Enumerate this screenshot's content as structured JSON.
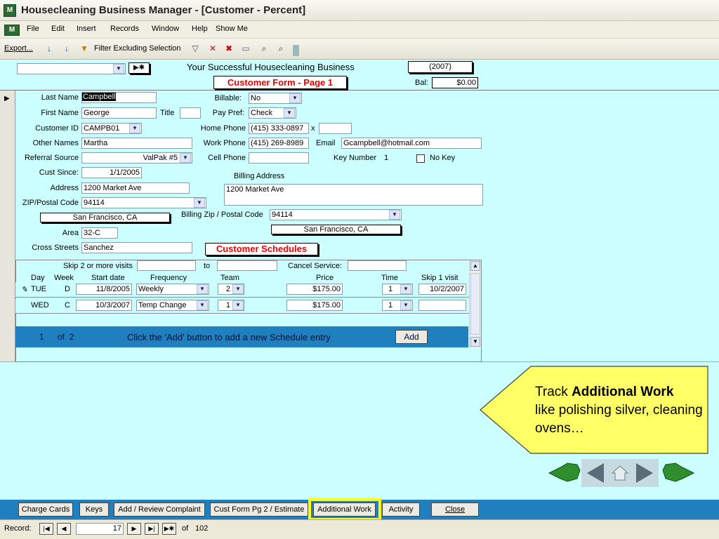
{
  "window": {
    "title": "Housecleaning Business Manager - [Customer - Percent]"
  },
  "menu": {
    "items": [
      "File",
      "Edit",
      "Insert",
      "Records",
      "Window",
      "Help",
      "Show Me"
    ]
  },
  "toolbar": {
    "export_label": "Export...",
    "filter_label": "Filter Excluding Selection"
  },
  "header": {
    "business_name": "Your Successful Housecleaning Business",
    "year": "(2007)",
    "form_title": "Customer Form - Page 1",
    "bal_label": "Bal:",
    "bal_value": "$0.00",
    "new_record_label": "▶✱"
  },
  "customer": {
    "last_name_label": "Last Name",
    "last_name": "Campbell",
    "first_name_label": "First Name",
    "first_name": "George",
    "title_label": "Title",
    "title": "",
    "customer_id_label": "Customer ID",
    "customer_id": "CAMPB01",
    "other_names_label": "Other Names",
    "other_names": "Martha",
    "referral_source_label": "Referral Source",
    "referral_source": "ValPak #5",
    "cust_since_label": "Cust Since:",
    "cust_since": "1/1/2005",
    "address_label": "Address",
    "address": "1200 Market Ave",
    "zip_label": "ZIP/Postal Code",
    "zip": "94114",
    "city_state": "San Francisco, CA",
    "area_label": "Area",
    "area": "32-C",
    "cross_streets_label": "Cross Streets",
    "cross_streets": "Sanchez",
    "billable_label": "Billable:",
    "billable": "No",
    "pay_pref_label": "Pay Pref:",
    "pay_pref": "Check",
    "home_phone_label": "Home Phone",
    "home_phone": "(415) 333-0897",
    "ext_label": "x",
    "ext": "",
    "work_phone_label": "Work Phone",
    "work_phone": "(415) 269-8989",
    "email_label": "Email",
    "email": "Gcampbell@hotmail.com",
    "cell_phone_label": "Cell Phone",
    "cell_phone": "",
    "key_number_label": "Key Number",
    "key_number": "1",
    "no_key_label": "No Key",
    "billing_address_label": "Billing Address",
    "billing_address": "1200 Market Ave",
    "billing_zip_label": "Billing Zip / Postal Code",
    "billing_zip": "94114",
    "billing_city_state": "San Francisco, CA",
    "schedules_title": "Customer Schedules"
  },
  "schedules": {
    "skip_label": "Skip 2 or more visits",
    "to_label": "to",
    "cancel_label": "Cancel Service:",
    "columns": [
      "Day",
      "Week",
      "Start date",
      "Frequency",
      "Team",
      "Price",
      "Time",
      "Skip 1 visit"
    ],
    "rows": [
      {
        "day": "TUE",
        "week": "D",
        "start": "11/8/2005",
        "freq": "Weekly",
        "team": "2",
        "price": "$175.00",
        "time": "1",
        "skip": "10/2/2007"
      },
      {
        "day": "WED",
        "week": "C",
        "start": "10/3/2007",
        "freq": "Temp Change",
        "team": "1",
        "price": "$175.00",
        "time": "1",
        "skip": ""
      }
    ],
    "nav_position": "1",
    "nav_of": "of  2",
    "nav_hint": "Click the 'Add' button to add a new Schedule entry",
    "add_label": "Add"
  },
  "callout": {
    "text_lead": "Track ",
    "text_bold": "Additional Work",
    "text_rest": "like polishing silver, cleaning ovens…"
  },
  "bottom_buttons": [
    "Charge Cards",
    "Keys",
    "Add / Review Complaint",
    "Cust Form Pg 2 / Estimate",
    "Additional Work",
    "Activity",
    "Close"
  ],
  "record_nav": {
    "label": "Record:",
    "current": "17",
    "of_label": "of",
    "total": "102"
  },
  "colors": {
    "form_bg": "#ccffff",
    "bar_blue": "#1f7fbf",
    "highlight": "#ffff00",
    "callout_bg": "#ffff66",
    "title_red": "#e00000"
  }
}
